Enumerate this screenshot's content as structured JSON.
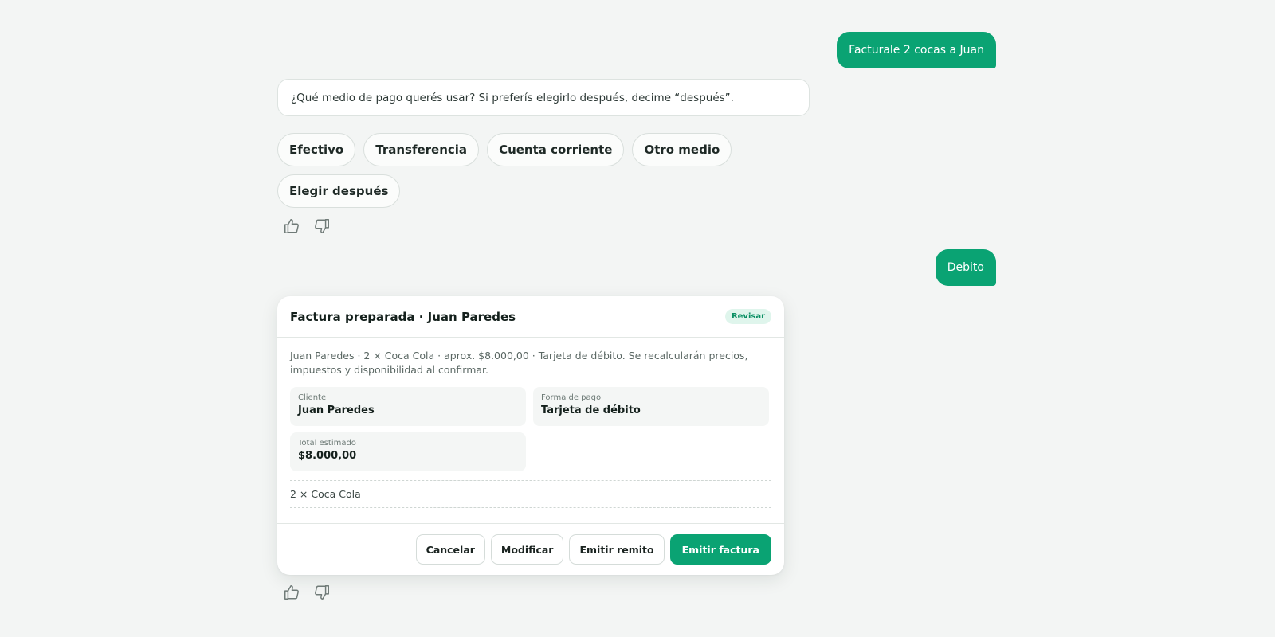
{
  "messages": {
    "user_1": "Facturale 2 cocas a Juan",
    "bot_question": "¿Qué medio de pago querés usar? Si preferís elegirlo después, decime “después”.",
    "user_2": "Debito"
  },
  "payment_options": [
    "Efectivo",
    "Transferencia",
    "Cuenta corriente",
    "Otro medio",
    "Elegir después"
  ],
  "feedback": {
    "like_icon": "thumbs-up-icon",
    "dislike_icon": "thumbs-down-icon"
  },
  "invoice_card": {
    "title": "Factura preparada · Juan Paredes",
    "badge": "Revisar",
    "description": "Juan Paredes · 2 × Coca Cola · aprox. $8.000,00 · Tarjeta de débito. Se recalcularán precios, impuestos y disponibilidad al confirmar.",
    "fields": {
      "client_label": "Cliente",
      "client_value": "Juan Paredes",
      "payment_label": "Forma de pago",
      "payment_value": "Tarjeta de débito",
      "total_label": "Total estimado",
      "total_value": "$8.000,00"
    },
    "items": [
      "2 × Coca Cola"
    ],
    "actions": {
      "cancel": "Cancelar",
      "modify": "Modificar",
      "emit_remito": "Emitir remito",
      "emit_invoice": "Emitir factura"
    }
  },
  "colors": {
    "accent": "#0aa373",
    "background": "#f3f5f4",
    "badge_bg": "#dff5ec",
    "badge_text": "#0a8f63"
  }
}
